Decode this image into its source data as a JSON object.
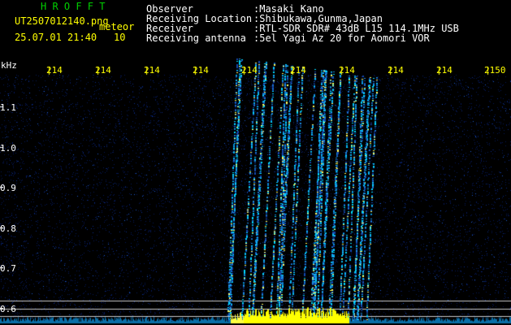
{
  "header": {
    "title": "H R O F F T",
    "filename": "UT2507012140.png",
    "mode": "meteor",
    "timestamp": "25.07.01 21:40",
    "count": "10",
    "fields": [
      {
        "label": "Observer",
        "value": ":Masaki Kano"
      },
      {
        "label": "Receiving Location",
        "value": ":Shibukawa,Gunma,Japan"
      },
      {
        "label": "Receiver",
        "value": ":RTL-SDR SDR# 43dB L15 114.1MHz USB"
      },
      {
        "label": "Receiving antenna",
        "value": ":5el Yagi Az 20 for Aomori VOR"
      }
    ]
  },
  "axes": {
    "y_unit": "kHz",
    "y_ticks": [
      "1.1",
      "1.0",
      "0.9",
      "0.8",
      "0.7",
      "0.6"
    ],
    "x_ticks": [
      "214",
      "214",
      "214",
      "214",
      "214",
      "214",
      "214",
      "214",
      "214",
      "2150"
    ]
  },
  "colors": {
    "background": "#000000",
    "noise": "#0a2a9a",
    "echo_bright": "#00c8ff",
    "echo_hot": "#ffff00",
    "reference_line": "#c8c8c8",
    "tick": "#ffff00"
  },
  "signal": {
    "description_free": true,
    "baseline_band_khz": [
      0.57,
      0.62
    ],
    "meteor_burst": {
      "start_tick_index": 4.5,
      "end_tick_index": 7.0,
      "freq_low_khz": 0.57,
      "freq_high_khz": 1.2
    }
  }
}
